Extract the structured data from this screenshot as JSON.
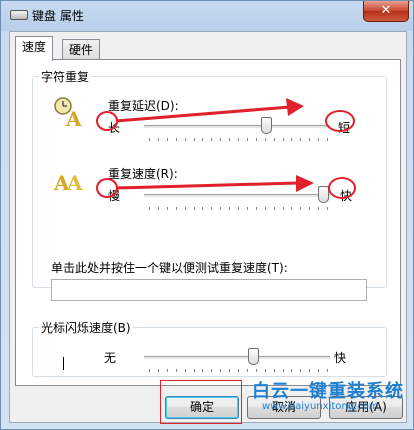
{
  "window": {
    "title": "键盘 属性",
    "close_glyph": "✕"
  },
  "tabs": [
    {
      "label": "速度",
      "active": true
    },
    {
      "label": "硬件",
      "active": false
    }
  ],
  "repeat_group": {
    "title": "字符重复",
    "delay": {
      "label": "重复延迟(D):",
      "min_label": "长",
      "max_label": "短",
      "value_fraction": 0.67
    },
    "rate": {
      "label": "重复速度(R):",
      "min_label": "慢",
      "max_label": "快",
      "value_fraction": 1.0
    },
    "test_label": "单击此处并按住一个键以便测试重复速度(T):",
    "test_value": ""
  },
  "cursor_group": {
    "title": "光标闪烁速度(B)",
    "min_label": "无",
    "max_label": "快",
    "value_fraction": 0.6
  },
  "buttons": {
    "ok": "确定",
    "cancel": "取消",
    "apply": "应用(A)"
  },
  "watermark": {
    "title": "白云一键重装系统",
    "url": "www.baiyunxitong.com"
  },
  "colors": {
    "annotation_red": "#e0202a",
    "watermark_blue": "#1f7fd0"
  }
}
